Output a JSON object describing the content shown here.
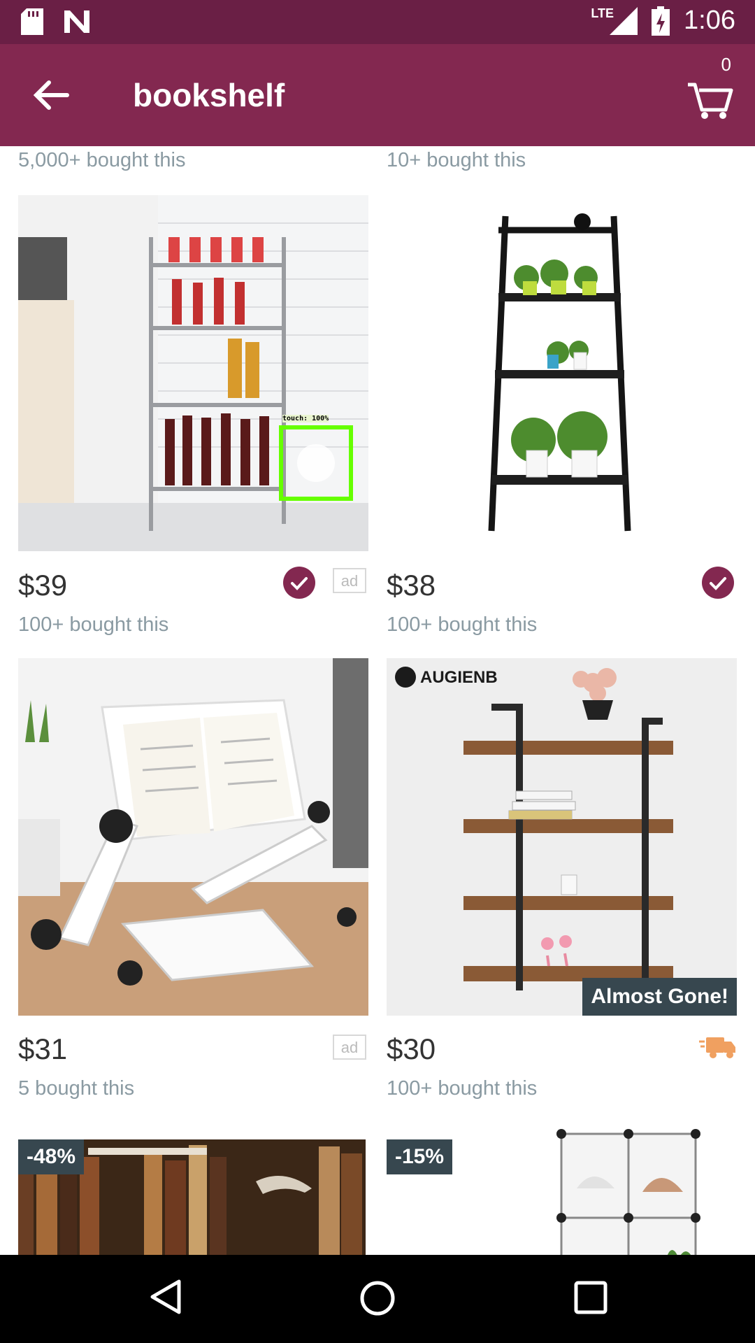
{
  "status_bar": {
    "time": "1:06",
    "network": "LTE",
    "icons": [
      "sd-card-icon",
      "n-notification-icon",
      "signal-icon",
      "battery-charging-icon"
    ]
  },
  "app_bar": {
    "title": "bookshelf",
    "cart_count": "0"
  },
  "top_row_partial": [
    {
      "bought": "5,000+ bought this"
    },
    {
      "bought": "10+ bought this"
    }
  ],
  "products": [
    {
      "price": "$39",
      "bought": "100+ bought this",
      "verified": true,
      "ad": "ad"
    },
    {
      "price": "$38",
      "bought": "100+ bought this",
      "verified": true
    },
    {
      "price": "$31",
      "bought": "5 bought this",
      "ad": "ad"
    },
    {
      "price": "$30",
      "bought": "100+ bought this",
      "brand": "AUGIENB",
      "badge": "Almost Gone!",
      "shipping_icon": "fast-shipping-icon"
    },
    {
      "discount": "-48%"
    },
    {
      "discount": "-15%"
    }
  ],
  "touch_overlay": "touch: 100%",
  "colors": {
    "status": "#6a1f45",
    "appbar": "#832850",
    "text_muted": "#8a9aa2",
    "badge": "#37474f",
    "shipping": "#f0a060"
  }
}
